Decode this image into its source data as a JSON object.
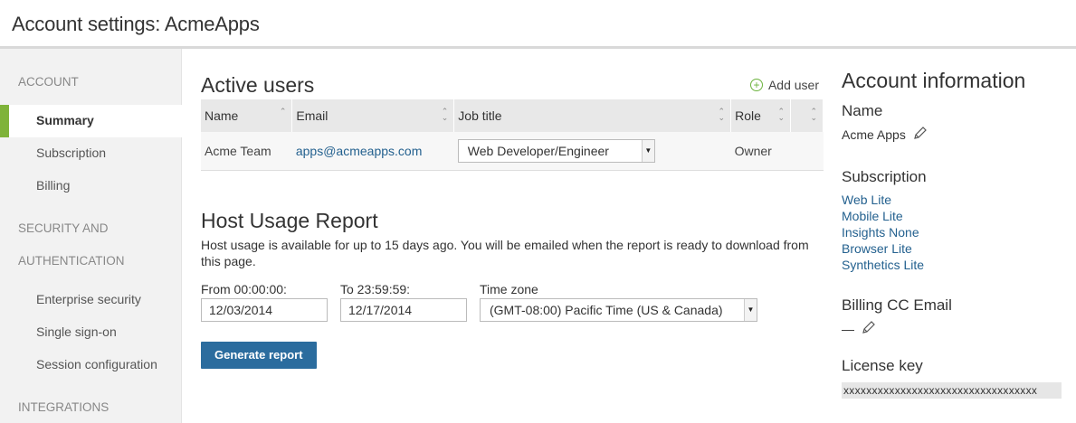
{
  "header": {
    "title": "Account settings: AcmeApps"
  },
  "sidebar": {
    "sections": [
      {
        "title": "ACCOUNT",
        "items": [
          "Summary",
          "Subscription",
          "Billing"
        ]
      },
      {
        "title": "SECURITY AND",
        "title2": "AUTHENTICATION",
        "items": [
          "Enterprise security",
          "Single sign-on",
          "Session configuration"
        ]
      },
      {
        "title": "INTEGRATIONS"
      }
    ],
    "active_item": "Summary",
    "accent_color": "#7fb33a"
  },
  "users": {
    "title": "Active users",
    "add_label": "Add user",
    "columns": [
      "Name",
      "Email",
      "Job title",
      "Role"
    ],
    "rows": [
      {
        "name": "Acme Team",
        "email": "apps@acmeapps.com",
        "job_title": "Web Developer/Engineer",
        "role": "Owner"
      }
    ]
  },
  "report": {
    "title": "Host Usage Report",
    "description": "Host usage is available for up to 15 days ago. You will be emailed when the report is ready to download from this page.",
    "from_label": "From 00:00:00:",
    "from_value": "12/03/2014",
    "to_label": "To 23:59:59:",
    "to_value": "12/17/2014",
    "tz_label": "Time zone",
    "tz_value": "(GMT-08:00) Pacific Time (US & Canada)",
    "button": "Generate report",
    "button_color": "#2b6c9e"
  },
  "info": {
    "title": "Account information",
    "name_label": "Name",
    "name_value": "Acme Apps",
    "subscription_label": "Subscription",
    "subscriptions": [
      "Web Lite",
      "Mobile Lite",
      "Insights None",
      "Browser Lite",
      "Synthetics Lite"
    ],
    "billing_label": "Billing CC Email",
    "billing_value": "—",
    "license_label": "License key",
    "license_value": "xxxxxxxxxxxxxxxxxxxxxxxxxxxxxxxxxx"
  }
}
